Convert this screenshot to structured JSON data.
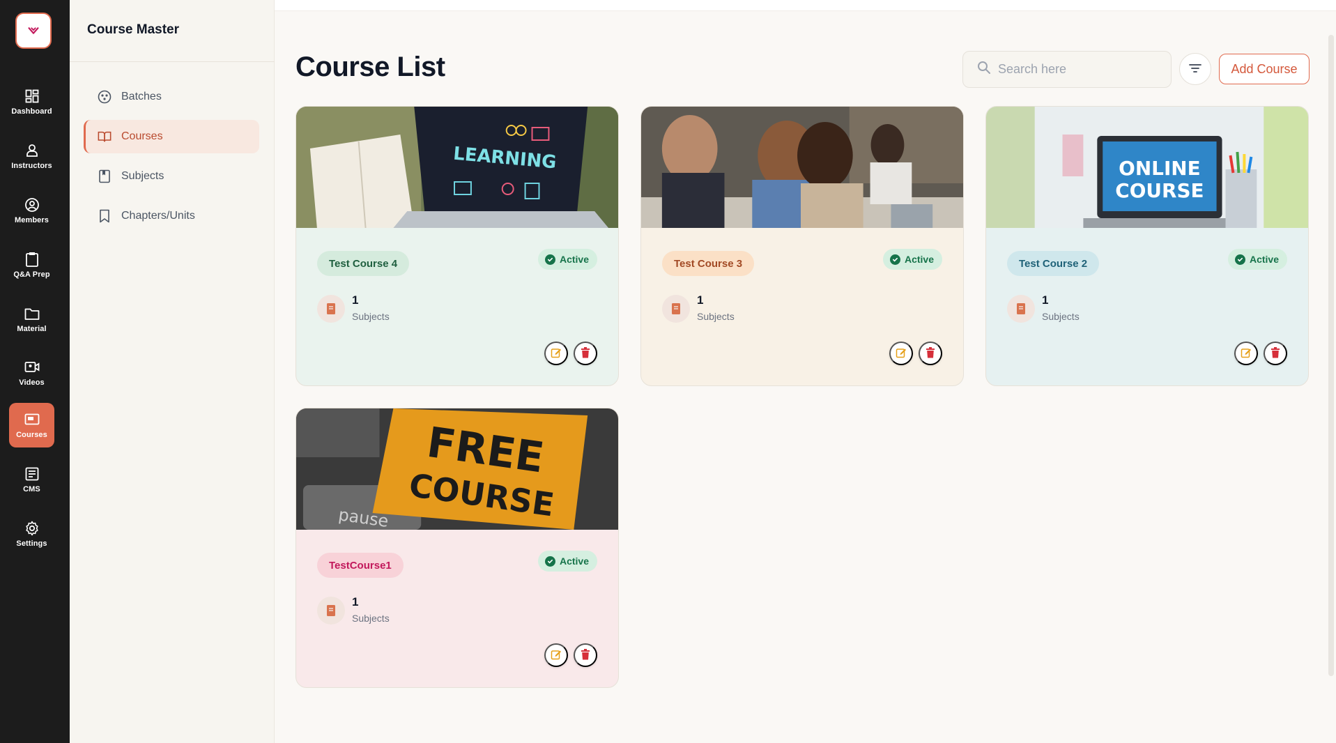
{
  "rail": {
    "items": [
      {
        "label": "Dashboard",
        "icon": "dashboard-icon"
      },
      {
        "label": "Instructors",
        "icon": "person-icon"
      },
      {
        "label": "Members",
        "icon": "user-circle-icon"
      },
      {
        "label": "Q&A Prep",
        "icon": "clipboard-icon"
      },
      {
        "label": "Material",
        "icon": "folder-icon"
      },
      {
        "label": "Videos",
        "icon": "video-icon"
      },
      {
        "label": "Courses",
        "icon": "courses-icon",
        "active": true
      },
      {
        "label": "CMS",
        "icon": "cms-icon"
      },
      {
        "label": "Settings",
        "icon": "gear-icon"
      }
    ]
  },
  "subnav": {
    "title": "Course Master",
    "items": [
      {
        "label": "Batches",
        "icon": "batches-icon"
      },
      {
        "label": "Courses",
        "icon": "book-open-icon",
        "active": true
      },
      {
        "label": "Subjects",
        "icon": "bookmark-book-icon"
      },
      {
        "label": "Chapters/Units",
        "icon": "bookmark-icon"
      }
    ]
  },
  "main": {
    "title": "Course List",
    "search_placeholder": "Search here",
    "add_label": "Add Course"
  },
  "courses": [
    {
      "name": "Test Course 4",
      "status": "Active",
      "count": "1",
      "count_label": "Subjects",
      "image": "LEARNING"
    },
    {
      "name": "Test Course 3",
      "status": "Active",
      "count": "1",
      "count_label": "Subjects",
      "image": "students"
    },
    {
      "name": "Test Course 2",
      "status": "Active",
      "count": "1",
      "count_label": "Subjects",
      "image": "ONLINE COURSE"
    },
    {
      "name": "TestCourse1",
      "status": "Active",
      "count": "1",
      "count_label": "Subjects",
      "image": "FREE COURSE"
    }
  ],
  "colors": {
    "accent": "#e06a4e",
    "rail_bg": "#1c1c1c",
    "card_green": "#eaf3ee",
    "card_beige": "#f8f1e6",
    "card_teal": "#e6f1f1",
    "card_pink": "#f9e9ea",
    "status_green": "#16734a"
  }
}
